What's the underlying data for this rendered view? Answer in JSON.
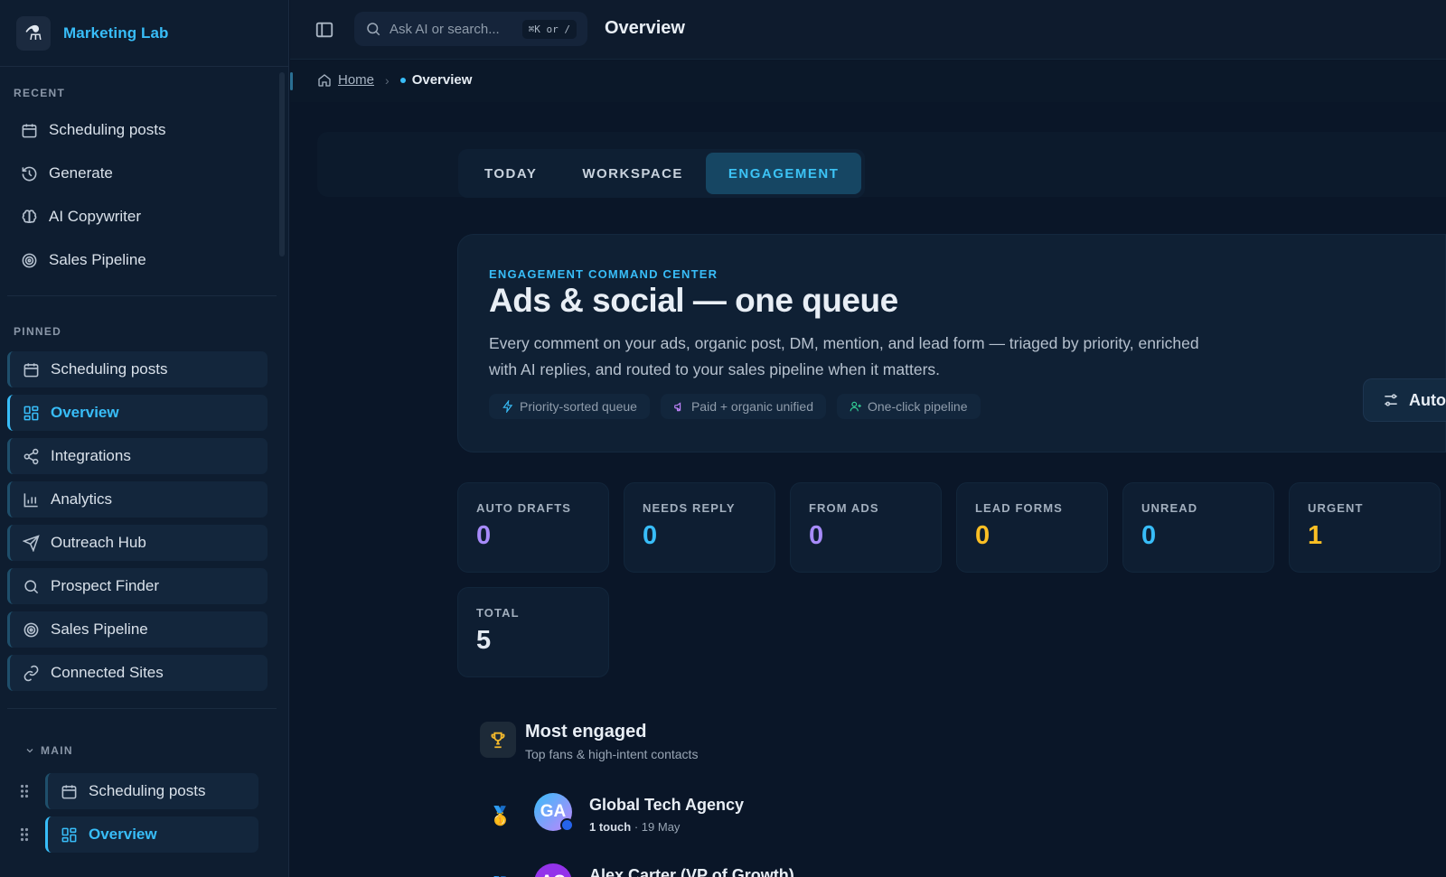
{
  "app": {
    "name": "Marketing Lab",
    "logo_icon": "flask-icon"
  },
  "sidebar": {
    "recent_title": "RECENT",
    "recent": [
      {
        "label": "Scheduling posts",
        "icon": "calendar-icon"
      },
      {
        "label": "Generate",
        "icon": "history-icon"
      },
      {
        "label": "AI Copywriter",
        "icon": "brain-icon"
      },
      {
        "label": "Sales Pipeline",
        "icon": "target-icon"
      }
    ],
    "pinned_title": "PINNED",
    "pinned": [
      {
        "label": "Scheduling posts",
        "icon": "calendar-icon",
        "active": false
      },
      {
        "label": "Overview",
        "icon": "dashboard-icon",
        "active": true
      },
      {
        "label": "Integrations",
        "icon": "share-icon",
        "active": false
      },
      {
        "label": "Analytics",
        "icon": "bar-chart-icon",
        "active": false
      },
      {
        "label": "Outreach Hub",
        "icon": "send-icon",
        "active": false
      },
      {
        "label": "Prospect Finder",
        "icon": "search-icon",
        "active": false
      },
      {
        "label": "Sales Pipeline",
        "icon": "target-icon",
        "active": false
      },
      {
        "label": "Connected Sites",
        "icon": "link-icon",
        "active": false
      }
    ],
    "main_title": "MAIN",
    "main": [
      {
        "label": "Scheduling posts",
        "icon": "calendar-icon",
        "active": false
      },
      {
        "label": "Overview",
        "icon": "dashboard-icon",
        "active": true
      }
    ]
  },
  "topbar": {
    "search_placeholder": "Ask AI or search...",
    "search_shortcut": "⌘K or /",
    "title": "Overview"
  },
  "breadcrumb": {
    "home": "Home",
    "separator": "›",
    "current": "Overview"
  },
  "tabs": [
    {
      "label": "TODAY",
      "active": false
    },
    {
      "label": "WORKSPACE",
      "active": false
    },
    {
      "label": "ENGAGEMENT",
      "active": true
    }
  ],
  "hero": {
    "eyebrow": "ENGAGEMENT COMMAND CENTER",
    "title": "Ads & social — one queue",
    "description": "Every comment on your ads, organic post, DM, mention, and lead form — triaged by priority, enriched with AI replies, and routed to your sales pipeline when it matters.",
    "chips": [
      {
        "label": "Priority-sorted queue",
        "icon": "lightning-icon",
        "color": "#38bdf8"
      },
      {
        "label": "Paid + organic unified",
        "icon": "megaphone-icon",
        "color": "#c084fc"
      },
      {
        "label": "One-click pipeline",
        "icon": "user-plus-icon",
        "color": "#34d399"
      }
    ],
    "auto_button": "Auto"
  },
  "stats": [
    {
      "label": "AUTO DRAFTS",
      "value": "0",
      "color": "#a78bfa"
    },
    {
      "label": "NEEDS REPLY",
      "value": "0",
      "color": "#38bdf8"
    },
    {
      "label": "FROM ADS",
      "value": "0",
      "color": "#a78bfa"
    },
    {
      "label": "LEAD FORMS",
      "value": "0",
      "color": "#fbbf24"
    },
    {
      "label": "UNREAD",
      "value": "0",
      "color": "#38bdf8"
    },
    {
      "label": "URGENT",
      "value": "1",
      "color": "#fbbf24"
    },
    {
      "label": "TOTAL",
      "value": "5",
      "color": "#e2e8f0"
    }
  ],
  "most_engaged": {
    "title": "Most engaged",
    "subtitle": "Top fans & high-intent contacts",
    "rows": [
      {
        "medal": "🥇",
        "initials": "GA",
        "name": "Global Tech Agency",
        "touches": "1 touch",
        "date": "· 19 May"
      },
      {
        "medal": "🥈",
        "initials": "AC",
        "name": "Alex Carter (VP of Growth)",
        "touches": "",
        "date": ""
      }
    ]
  }
}
